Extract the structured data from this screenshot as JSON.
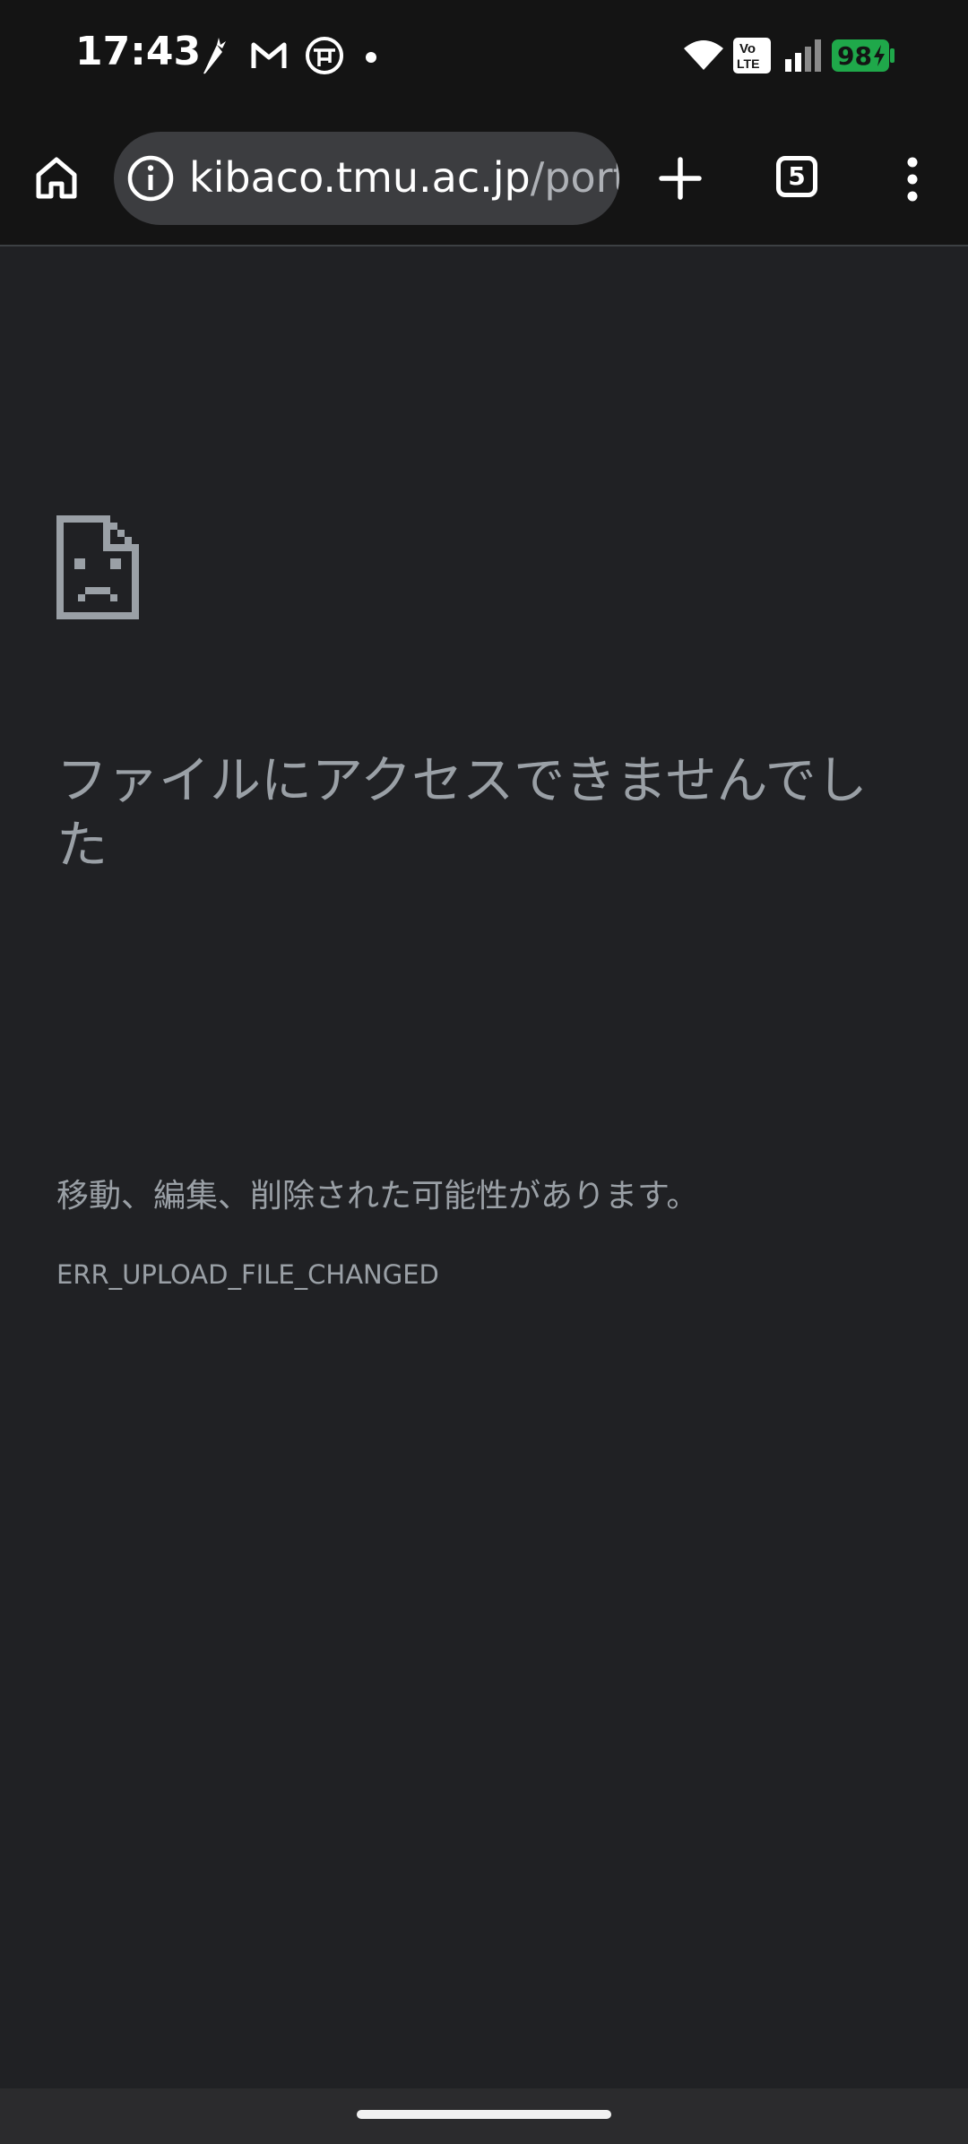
{
  "status_bar": {
    "time": "17:43",
    "notification_icons": [
      "carrot-icon",
      "gmail-icon",
      "globe-app-icon",
      "more-dot-icon"
    ],
    "volte_label": "Vo\nLTE",
    "battery_percent": "98",
    "colors": {
      "battery": "#1fa84a"
    }
  },
  "browser": {
    "url_host": "kibaco.tmu.ac.jp",
    "url_path": "/port",
    "tab_count": "5"
  },
  "error_page": {
    "title": "ファイルにアクセスできませんでした",
    "description": "移動、編集、削除された可能性があります。",
    "code": "ERR_UPLOAD_FILE_CHANGED",
    "icon": "sad-file-icon"
  }
}
